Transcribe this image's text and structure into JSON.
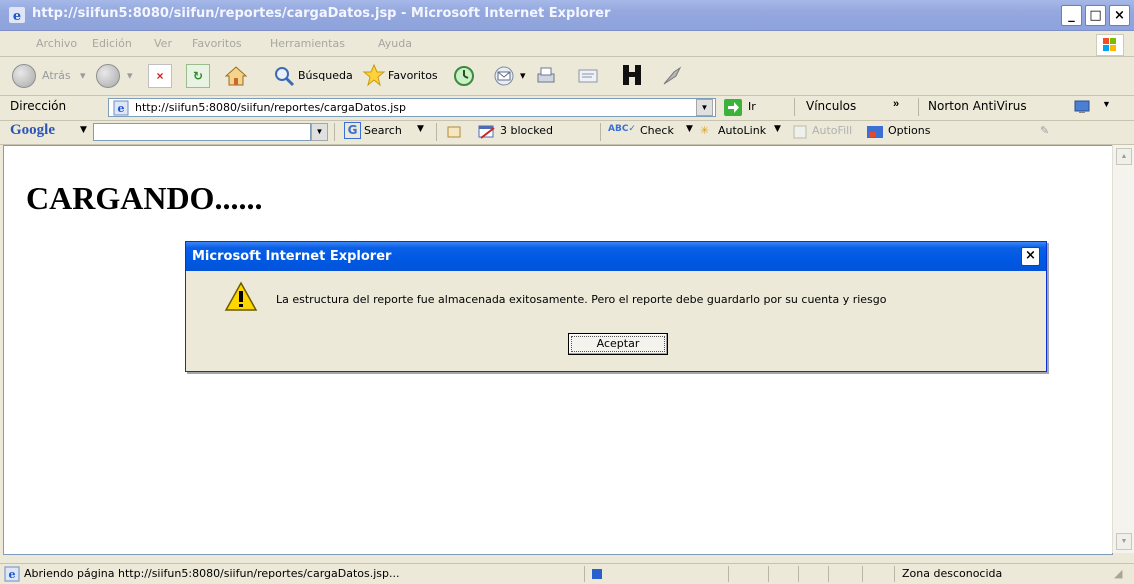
{
  "window": {
    "title": "http://siifun5:8080/siifun/reportes/cargaDatos.jsp - Microsoft Internet Explorer",
    "buttons": {
      "minimize": "_",
      "maximize": "□",
      "close": "×"
    }
  },
  "menu": {
    "items": [
      "Archivo",
      "Edición",
      "Ver",
      "Favoritos",
      "Herramientas",
      "Ayuda"
    ]
  },
  "toolbar": {
    "back_label": "Atrás",
    "search_label": "Búsqueda",
    "favorites_label": "Favoritos"
  },
  "address": {
    "label": "Dirección",
    "url": "http://siifun5:8080/siifun/reportes/cargaDatos.jsp",
    "go_label": "Ir",
    "links_label": "Vínculos",
    "links_chevron": "»",
    "norton_label": "Norton AntiVirus"
  },
  "google_bar": {
    "logo": "Google",
    "search_label": "Search",
    "blocked_label": "3 blocked",
    "check_label": "Check",
    "autolink_label": "AutoLink",
    "autofill_label": "AutoFill",
    "options_label": "Options"
  },
  "page": {
    "heading": "CARGANDO......"
  },
  "dialog": {
    "title": "Microsoft Internet Explorer",
    "message": "La estructura del reporte fue almacenada exitosamente. Pero el reporte debe guardarlo por su cuenta y riesgo",
    "button_label": "Aceptar",
    "close": "×"
  },
  "status": {
    "text": "Abriendo página http://siifun5:8080/siifun/reportes/cargaDatos.jsp...",
    "zone": "Zona desconocida"
  }
}
